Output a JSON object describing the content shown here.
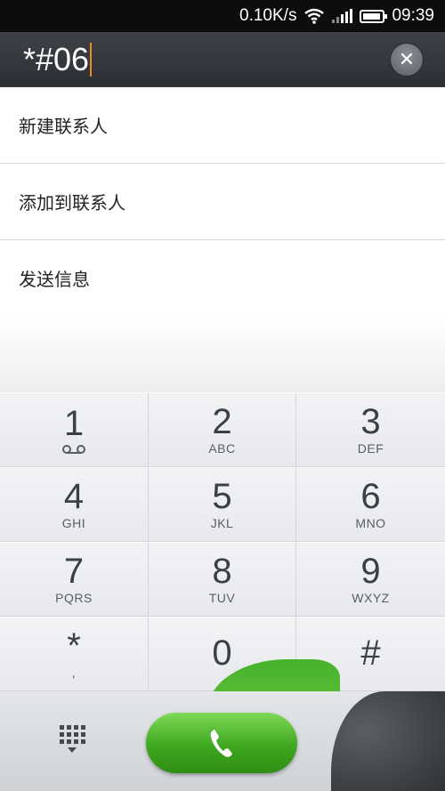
{
  "status_bar": {
    "net_speed": "0.10K/s",
    "time": "09:39"
  },
  "dialer": {
    "input_value": "*#06"
  },
  "menu": {
    "items": [
      {
        "label": "新建联系人"
      },
      {
        "label": "添加到联系人"
      },
      {
        "label": "发送信息"
      }
    ]
  },
  "keypad": {
    "keys": [
      {
        "digit": "1",
        "letters": ""
      },
      {
        "digit": "2",
        "letters": "ABC"
      },
      {
        "digit": "3",
        "letters": "DEF"
      },
      {
        "digit": "4",
        "letters": "GHI"
      },
      {
        "digit": "5",
        "letters": "JKL"
      },
      {
        "digit": "6",
        "letters": "MNO"
      },
      {
        "digit": "7",
        "letters": "PQRS"
      },
      {
        "digit": "8",
        "letters": "TUV"
      },
      {
        "digit": "9",
        "letters": "WXYZ"
      },
      {
        "digit": "*",
        "letters": ","
      },
      {
        "digit": "0",
        "letters": ""
      },
      {
        "digit": "#",
        "letters": ""
      }
    ]
  },
  "colors": {
    "call_green": "#3ea71f",
    "cursor_orange": "#f08a1c",
    "header_dark": "#2c2f34"
  }
}
